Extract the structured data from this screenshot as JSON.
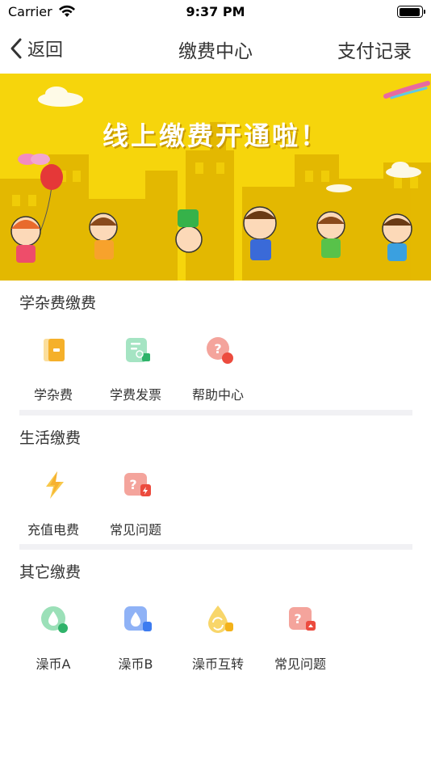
{
  "status_bar": {
    "carrier": "Carrier",
    "time": "9:37 PM"
  },
  "nav": {
    "back_label": "返回",
    "title": "缴费中心",
    "right_label": "支付记录"
  },
  "banner": {
    "headline": "线上缴费开通啦！"
  },
  "sections": [
    {
      "title": "学杂费缴费",
      "items": [
        {
          "label": "学杂费",
          "icon": "tuition-icon",
          "color": "#f7c34a"
        },
        {
          "label": "学费发票",
          "icon": "invoice-icon",
          "color": "#37c379"
        },
        {
          "label": "帮助中心",
          "icon": "help-icon",
          "color": "#ef5a4e"
        }
      ]
    },
    {
      "title": "生活缴费",
      "items": [
        {
          "label": "充值电费",
          "icon": "lightning-icon",
          "color": "#f6b52a"
        },
        {
          "label": "常见问题",
          "icon": "faq-icon",
          "color": "#ef5a4e"
        }
      ]
    },
    {
      "title": "其它缴费",
      "items": [
        {
          "label": "澡币A",
          "icon": "water-drop-icon",
          "color": "#37c379"
        },
        {
          "label": "澡币B",
          "icon": "water-drop-icon",
          "color": "#3d7cf0"
        },
        {
          "label": "澡币互转",
          "icon": "exchange-icon",
          "color": "#f6c73a"
        },
        {
          "label": "常见问题",
          "icon": "faq-icon",
          "color": "#ef5a4e"
        }
      ]
    }
  ]
}
